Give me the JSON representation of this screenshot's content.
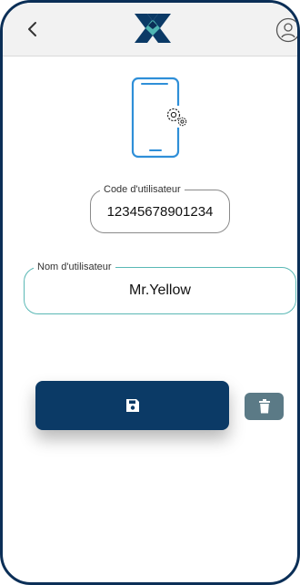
{
  "header": {
    "back_icon": "chevron-left-icon",
    "logo_icon": "brand-x-logo",
    "profile_icon": "user-circle-icon"
  },
  "illustration": {
    "icon": "phone-settings-icon"
  },
  "code_field": {
    "label": "Code d'utilisateur",
    "value": "12345678901234"
  },
  "name_field": {
    "label": "Nom d'utilisateur",
    "value": "Mr.Yellow"
  },
  "actions": {
    "save_icon": "floppy-disk-icon",
    "delete_icon": "trash-icon"
  },
  "colors": {
    "frame": "#0b2f57",
    "primary": "#0b3a66",
    "accent": "#5ab8b5",
    "phone_blue": "#2f8fd8",
    "delete_grey": "#5b7a86",
    "header_bg": "#f2f2f2"
  }
}
